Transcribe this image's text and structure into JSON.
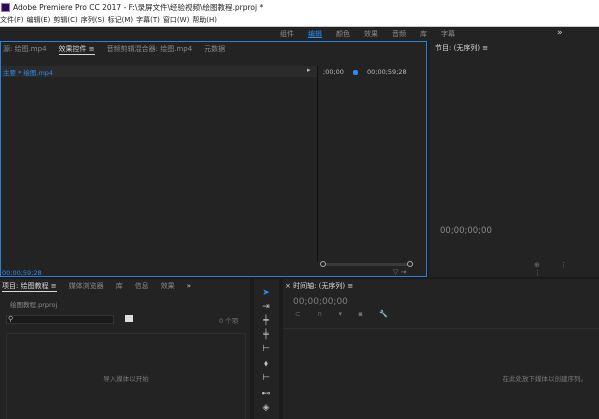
{
  "window": {
    "title": "Adobe Premiere Pro CC 2017 - F:\\录屏文件\\经验视频\\绘图教程.prproj *"
  },
  "menu": [
    "文件(F)",
    "编辑(E)",
    "剪辑(C)",
    "序列(S)",
    "标记(M)",
    "字幕(T)",
    "窗口(W)",
    "帮助(H)"
  ],
  "workspaces": {
    "tabs": [
      "组件",
      "编辑",
      "颜色",
      "效果",
      "音频",
      "库",
      "字幕"
    ],
    "active": "编辑",
    "more": "»"
  },
  "effect_controls": {
    "tabs": [
      "源: 绘图.mp4",
      "效果控件 ≡",
      "音频剪辑混合器: 绘图.mp4",
      "元数据"
    ],
    "active_tab": "效果控件 ≡",
    "sequence_label": "主要 * 绘图.mp4",
    "arrow": "▸",
    "time_start": ";00;00",
    "time_end": "00;00;59;28",
    "current_time": "00;00;59;28",
    "bottom_icons": "▽ ⇥"
  },
  "program_monitor": {
    "tab": "节目: (无序列) ≡",
    "timecode": "00;00;00;00",
    "controls": "⊕ ⋮ ⋮"
  },
  "project": {
    "tabs": [
      "项目: 绘图教程 ≡",
      "媒体浏览器",
      "库",
      "信息",
      "效果",
      "»"
    ],
    "active_tab": "项目: 绘图教程 ≡",
    "file": "绘图教程.prproj",
    "search_icon": "search-icon",
    "item_count": "0 个项",
    "import_hint": "导入媒体以开始"
  },
  "tools": [
    "selection-tool",
    "track-select-tool",
    "ripple-edit-tool",
    "razor-tool",
    "slip-tool",
    "pen-tool",
    "hand-tool",
    "type-tool",
    "zoom-tool"
  ],
  "timeline": {
    "tab": "× 时间轴: (无序列) ≡",
    "timecode": "00;00;00;00",
    "icons": "⊂ ∩ ▾ ▪ 🔧",
    "drop_hint": "在此处放下媒体以创建序列。"
  },
  "colors": {
    "accent": "#2d8ceb",
    "panel_bg": "#232323",
    "gutter": "#1b1b1b"
  }
}
